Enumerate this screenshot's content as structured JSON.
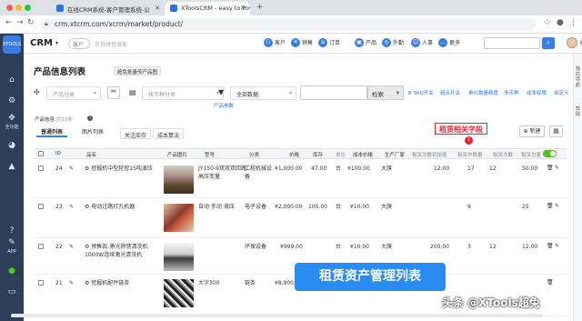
{
  "browser": {
    "tabs": [
      {
        "title": "在线CRM系统-客户管理系统-公"
      },
      {
        "title": "XToolsCRM - easy to Power"
      }
    ],
    "url": "crm.xtcrm.com/xcrm/market/product/"
  },
  "sidebar": {
    "logo": "XTOOLS",
    "items": [
      {
        "icon": "home-icon",
        "glyph": "⌂"
      },
      {
        "icon": "gear-icon",
        "glyph": "⚙"
      },
      {
        "icon": "puzzle-icon",
        "glyph": "✥"
      },
      {
        "label": "全功能"
      },
      {
        "icon": "dashboard-icon",
        "glyph": "◕"
      },
      {
        "icon": "chart-icon",
        "glyph": "▲"
      },
      {
        "icon": "help-icon",
        "glyph": "?"
      },
      {
        "icon": "notification-icon",
        "glyph": "✎"
      },
      {
        "label": "APP"
      },
      {
        "icon": "wechat-icon",
        "glyph": "●"
      },
      {
        "icon": "monitor-icon",
        "glyph": "▭"
      }
    ]
  },
  "header": {
    "title": "CRM",
    "customer_select": "客户",
    "search_placeholder": "支持拼音搜索",
    "nav": [
      {
        "label": "客户",
        "icon": "customer-icon"
      },
      {
        "label": "销售",
        "icon": "sales-icon"
      },
      {
        "label": "订单",
        "icon": "order-icon"
      },
      {
        "label": "产品",
        "icon": "product-icon"
      },
      {
        "label": "外勤",
        "icon": "field-icon"
      },
      {
        "label": "人事",
        "icon": "hr-icon"
      },
      {
        "label": "更多",
        "icon": "more-icon"
      }
    ],
    "username": "boss"
  },
  "rightstrip": {
    "label1": "我的导航",
    "label2": "帮助"
  },
  "main": {
    "page_title": "产品信息列表",
    "batch_button": "超免批量传产品图",
    "filters": {
      "product_category": "产品分类",
      "currency_category": "按币种分类",
      "all_data": "全部数据",
      "search_button": "检索"
    },
    "toolbar_links": [
      "SKU开关",
      "组合开关",
      "单价数量精度",
      "多币种",
      "成本权限",
      "自定义"
    ],
    "product_params": "产品参数",
    "info_label": "产品信息",
    "info_count": "共33条",
    "view_tabs": [
      "普通列表",
      "图片列表"
    ],
    "pill_buttons": [
      "关注库存",
      "成本算法"
    ],
    "annotation": "租赁相关字段",
    "annotation_badge": "1",
    "new_button": "新建",
    "columns": [
      "ID",
      "品名",
      "产品图片",
      "型号",
      "分类",
      "价格",
      "库存",
      "单位",
      "成本价格",
      "生产厂家",
      "租赁次数初始值",
      "租赁中数量",
      "租赁次数",
      "租赁总量"
    ],
    "rows": [
      {
        "id": "24",
        "name": "挖掘机中型轮挖15吨液压",
        "model": "JY150-9双双双回路高压变量",
        "category": "工程机械设备",
        "price": "¥1,000.00",
        "stock": "47.00",
        "unit": "台",
        "cost": "¥100.00",
        "maker": "大旗",
        "init": "12.00",
        "renting": "17",
        "count": "12",
        "total": "50.00"
      },
      {
        "id": "23",
        "name": "电动过路打孔机器",
        "model": "自动 手动 液压",
        "category": "电子设备",
        "price": "¥2,000.00",
        "stock": "105.00",
        "unit": "台",
        "cost": "¥10.00",
        "maker": "大旗",
        "init": "",
        "renting": "9",
        "count": "",
        "total": "25"
      },
      {
        "id": "22",
        "name": "预售款-激光除锈清洗机1000W连续激光清洗机",
        "model": "",
        "category": "环保设备",
        "price": "¥999.00",
        "stock": "",
        "unit": "台",
        "cost": "¥10.00",
        "maker": "大旗",
        "init": "200.00",
        "renting": "3",
        "count": "12",
        "total": "12.00"
      },
      {
        "id": "21",
        "name": "挖掘机配件链条",
        "model": "大字300",
        "category": "链条",
        "price": "¥8,900.00",
        "stock": "",
        "unit": "",
        "cost": "",
        "maker": "",
        "init": "",
        "renting": "",
        "count": "",
        "total": ""
      }
    ],
    "overlay_banner": "租赁资产管理列表",
    "watermark": "头条 @XTools超兔"
  }
}
